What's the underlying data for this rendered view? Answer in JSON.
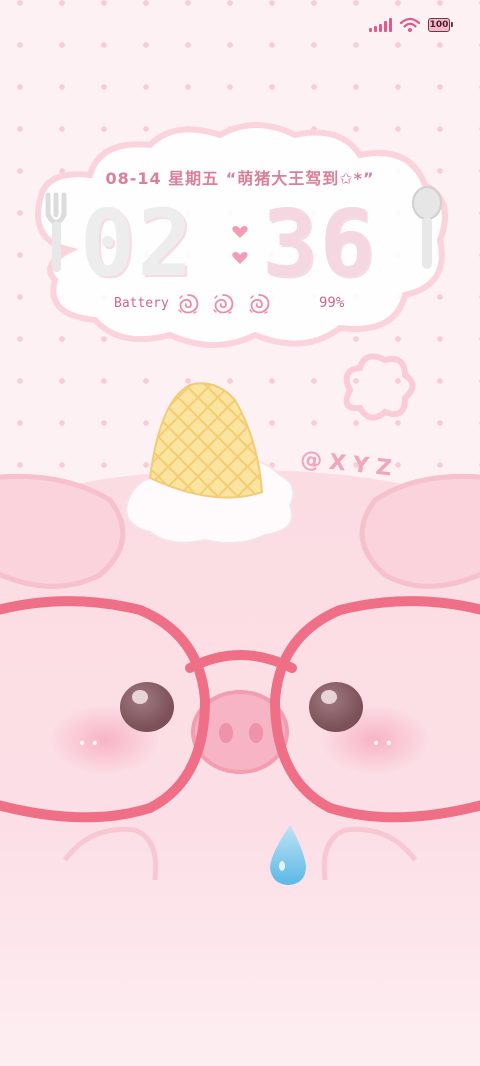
{
  "status_bar": {
    "battery_level": "100",
    "icons": [
      "signal-icon",
      "wifi-icon",
      "battery-icon"
    ],
    "accent_color": "#e05a8c"
  },
  "lockscreen": {
    "date_line": "08-14 星期五 “萌猪大王驾到✩*”",
    "clock": {
      "hours": "02",
      "minutes": "36"
    },
    "battery": {
      "label": "Battery",
      "percent": "99%"
    },
    "signature": "@XYZ"
  },
  "wallpaper": {
    "theme": "cute pink pig with red glasses",
    "colors": {
      "background": "#fdf1f4",
      "dots": "#f7cdd8",
      "pig": "#fbdde4",
      "glasses": "#ef6f87",
      "text": "#d9809a"
    }
  }
}
